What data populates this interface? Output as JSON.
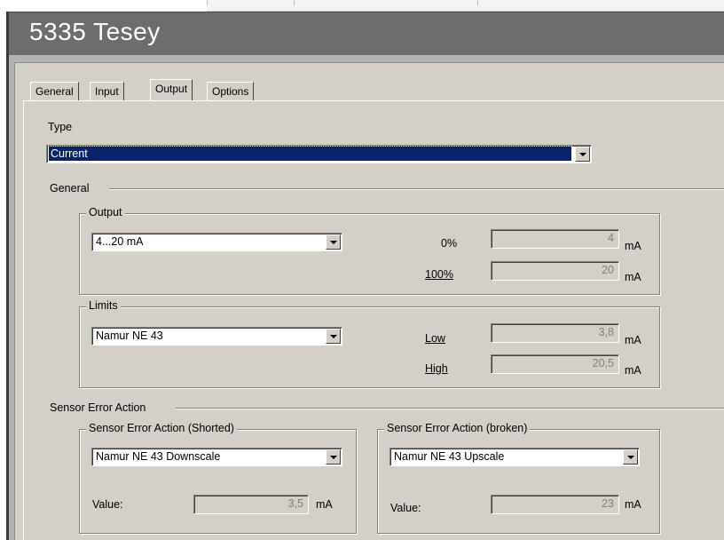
{
  "header": {
    "title": "5335 Tesey"
  },
  "tabs": [
    {
      "label": "General"
    },
    {
      "label": "Input"
    },
    {
      "label": "Output"
    },
    {
      "label": "Options"
    }
  ],
  "type_section": {
    "label": "Type",
    "selected": "Current"
  },
  "general_section": {
    "label": "General",
    "output_group": {
      "label": "Output",
      "selected": "4...20 mA",
      "rows": [
        {
          "label": "0%",
          "value": "4",
          "unit": "mA"
        },
        {
          "label": "100%",
          "value": "20",
          "unit": "mA"
        }
      ]
    },
    "limits_group": {
      "label": "Limits",
      "selected": "Namur NE 43",
      "rows": [
        {
          "label": "Low",
          "value": "3,8",
          "unit": "mA"
        },
        {
          "label": "High",
          "value": "20,5",
          "unit": "mA"
        }
      ]
    }
  },
  "sensor_error_section": {
    "label": "Sensor Error Action",
    "shorted": {
      "label": "Sensor Error Action (Shorted)",
      "selected": "Namur NE 43 Downscale",
      "value_label": "Value:",
      "value": "3,5",
      "unit": "mA"
    },
    "broken": {
      "label": "Sensor Error Action (broken)",
      "selected": "Namur NE 43 Upscale",
      "value_label": "Value:",
      "value": "23",
      "unit": "mA"
    }
  },
  "colors": {
    "dialog_bg": "#d4d0c8",
    "title_bar": "#6d6d6d",
    "selection": "#0a246a"
  }
}
